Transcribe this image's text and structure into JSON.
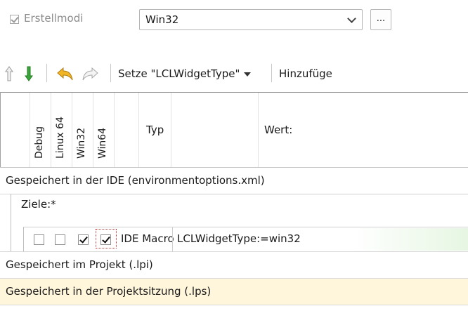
{
  "top_bar": {
    "build_modes_label": "Erstellmodi",
    "build_modes_checked": true,
    "combo_value": "Win32",
    "dots_button_label": "..."
  },
  "toolbar": {
    "icons": [
      "arrow-up-icon",
      "arrow-down-icon",
      "undo-icon",
      "redo-icon"
    ],
    "set_button_label": "Setze \"LCLWidgetType\"",
    "add_button_label": "Hinzufüge"
  },
  "grid": {
    "columns": {
      "debug": "Debug",
      "linux64": "Linux 64",
      "win32": "Win32",
      "win64": "Win64",
      "type": "Typ",
      "value": "Wert:"
    },
    "groups": {
      "ide": "Gespeichert in der IDE (environmentoptions.xml)",
      "targets": "Ziele:*",
      "project": "Gespeichert im Projekt (.lpi)",
      "session": "Gespeichert in der Projektsitzung (.lps)"
    },
    "rows": [
      {
        "debug": false,
        "linux64": false,
        "win32": true,
        "win64": true,
        "type": "IDE Macro",
        "value": "LCLWidgetType:=win32"
      }
    ]
  },
  "colors": {
    "session_row_bg": "#fff6dc",
    "green_accent": "#3aa53a",
    "undo_accent": "#e2a51a"
  }
}
